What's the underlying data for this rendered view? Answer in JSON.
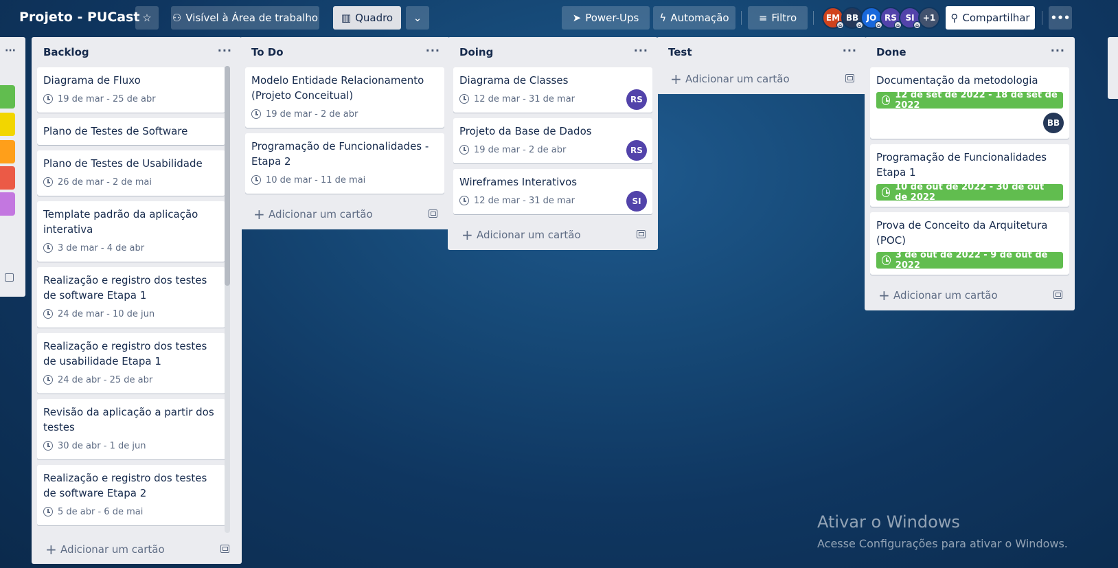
{
  "header": {
    "board_title": "Projeto - PUCast",
    "star_icon": "star-icon",
    "visibility_label": "Visível à Área de trabalho",
    "view_label": "Quadro",
    "powerups_label": "Power-Ups",
    "automation_label": "Automação",
    "filter_label": "Filtro",
    "share_label": "Compartilhar",
    "more_label": "•••",
    "members": [
      {
        "initials": "EM",
        "color": "#d0431d"
      },
      {
        "initials": "BB",
        "color": "#253858"
      },
      {
        "initials": "JO",
        "color": "#1868db"
      },
      {
        "initials": "RS",
        "color": "#5243aa"
      },
      {
        "initials": "SI",
        "color": "#5243aa"
      }
    ],
    "extra_members": "+1"
  },
  "lists": [
    {
      "title": "Backlog",
      "add_card": "Adicionar um cartão",
      "cards": [
        {
          "title": "Diagrama de Fluxo",
          "due": "19 de mar - 25 de abr"
        },
        {
          "title": "Plano de Testes de Software"
        },
        {
          "title": "Plano de Testes de Usabilidade",
          "due": "26 de mar - 2 de mai"
        },
        {
          "title": "Template padrão da aplicação interativa",
          "due": "3 de mar - 4 de abr"
        },
        {
          "title": "Realização e registro dos testes de software Etapa 1",
          "due": "24 de mar - 10 de jun"
        },
        {
          "title": "Realização e registro dos testes de usabilidade Etapa 1",
          "due": "24 de abr - 25 de abr"
        },
        {
          "title": "Revisão da aplicação a partir dos testes",
          "due": "30 de abr - 1 de jun"
        },
        {
          "title": "Realização e registro dos testes de software Etapa 2",
          "due": "5 de abr - 6 de mai"
        }
      ]
    },
    {
      "title": "To Do",
      "add_card": "Adicionar um cartão",
      "cards": [
        {
          "title": "Modelo Entidade Relacionamento (Projeto Conceitual)",
          "due": "19 de mar - 2 de abr"
        },
        {
          "title": "Programação de Funcionalidades - Etapa 2",
          "due": "10 de mar - 11 de mai"
        }
      ]
    },
    {
      "title": "Doing",
      "add_card": "Adicionar um cartão",
      "cards": [
        {
          "title": "Diagrama de Classes",
          "due": "12 de mar - 31 de mar",
          "member": "RS"
        },
        {
          "title": "Projeto da Base de Dados",
          "due": "19 de mar - 2 de abr",
          "member": "RS"
        },
        {
          "title": "Wireframes Interativos",
          "due": "12 de mar - 31 de mar",
          "member": "SI"
        }
      ]
    },
    {
      "title": "Test",
      "add_card": "Adicionar um cartão",
      "cards": []
    },
    {
      "title": "Done",
      "add_card": "Adicionar um cartão",
      "cards": [
        {
          "title": "Documentação da metodologia",
          "due": "12 de set de 2022 - 18 de set de 2022",
          "member": "BB",
          "complete": true
        },
        {
          "title": "Programação de Funcionalidades Etapa 1",
          "due": "10 de out de 2022 - 30 de out de 2022",
          "complete": true
        },
        {
          "title": "Prova de Conceito da Arquitetura (POC)",
          "due": "3 de out de 2022 - 9 de out de 2022",
          "complete": true
        }
      ]
    }
  ],
  "colors": {
    "label_green": "#61bd4f",
    "label_yellow": "#f2d600",
    "label_orange": "#ff9f1a",
    "label_red": "#eb5a46",
    "label_purple": "#c377e0",
    "member_purple": "#5243aa",
    "member_navy": "#253858"
  },
  "watermark": {
    "title": "Ativar o Windows",
    "subtitle": "Acesse Configurações para ativar o Windows."
  }
}
